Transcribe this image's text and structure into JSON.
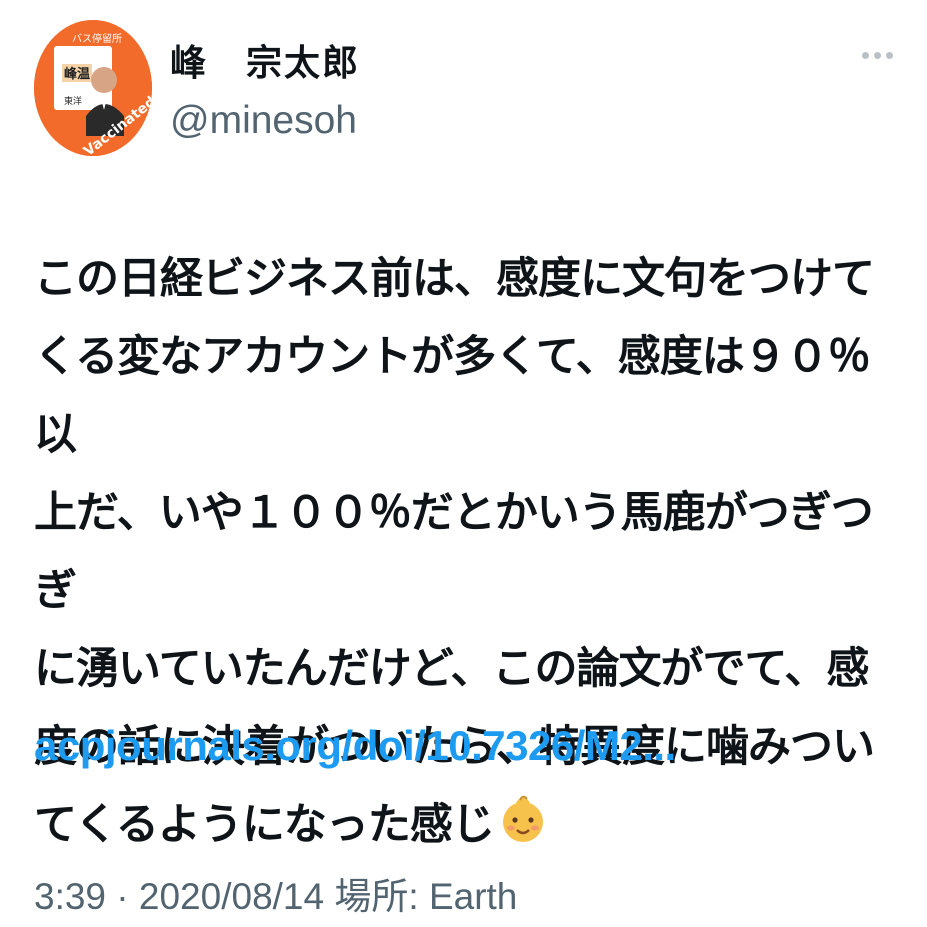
{
  "tweet": {
    "author_name": "峰　宗太郎",
    "author_handle": "@minesoh",
    "avatar": {
      "top_text": "バス停留所",
      "badge_text": "I'm Vaccinated",
      "sign_text": "峰温",
      "side_text": "東洋",
      "color": "#f26b2a"
    },
    "more_icon": "more-horizontal-icon",
    "text": "この日経ビジネス前は、感度に文句をつけて\nくる変なアカウントが多くて、感度は９０％以\n上だ、いや１００％だとかいう馬鹿がつぎつぎ\nに湧いていたんだけど、この論文がでて、感\n度の話に決着がついたら、特異度に噛みつい\nてくるようになった感じ",
    "emoji": "baby-face-emoji",
    "link": "acpjournals.org/doi/10.7326/M2...",
    "time": "3:39",
    "separator": "·",
    "date": "2020/08/14",
    "location_label": "場所:",
    "location": "Earth"
  },
  "colors": {
    "text": "#0f1419",
    "secondary": "#536471",
    "link": "#1d9bf0",
    "avatar_bg": "#f26b2a"
  }
}
